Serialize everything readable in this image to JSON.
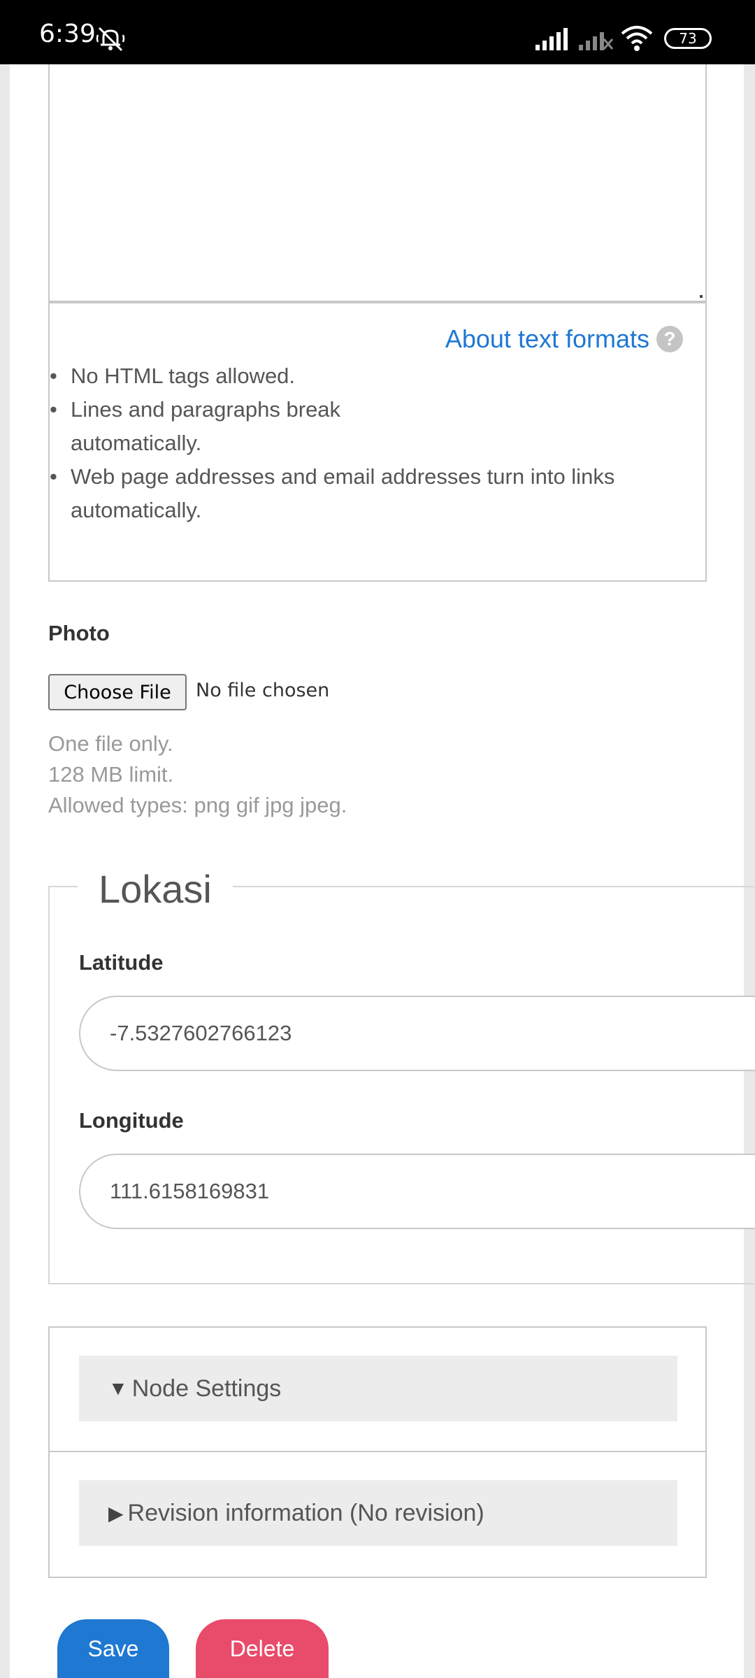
{
  "status_bar": {
    "time": "6:39",
    "battery": "73"
  },
  "text_format": {
    "about_link": "About text formats",
    "help_icon": "?",
    "tips": [
      "No HTML tags allowed.",
      "Lines and paragraphs break automatically.",
      "Web page addresses and email addresses turn into links automatically."
    ]
  },
  "photo": {
    "label": "Photo",
    "choose_button": "Choose File",
    "no_file": "No file chosen",
    "help": [
      "One file only.",
      "128 MB limit.",
      "Allowed types: png gif jpg jpeg."
    ]
  },
  "lokasi": {
    "legend": "Lokasi",
    "latitude_label": "Latitude",
    "latitude_value": "-7.5327602766123",
    "longitude_label": "Longitude",
    "longitude_value": "111.6158169831"
  },
  "sections": {
    "node_settings": "Node Settings",
    "revision_info": "Revision information (No revision)"
  },
  "actions": {
    "save": "Save",
    "delete": "Delete"
  },
  "colors": {
    "link": "#1f78d1",
    "save": "#1f78d1",
    "delete": "#e94b6a"
  }
}
